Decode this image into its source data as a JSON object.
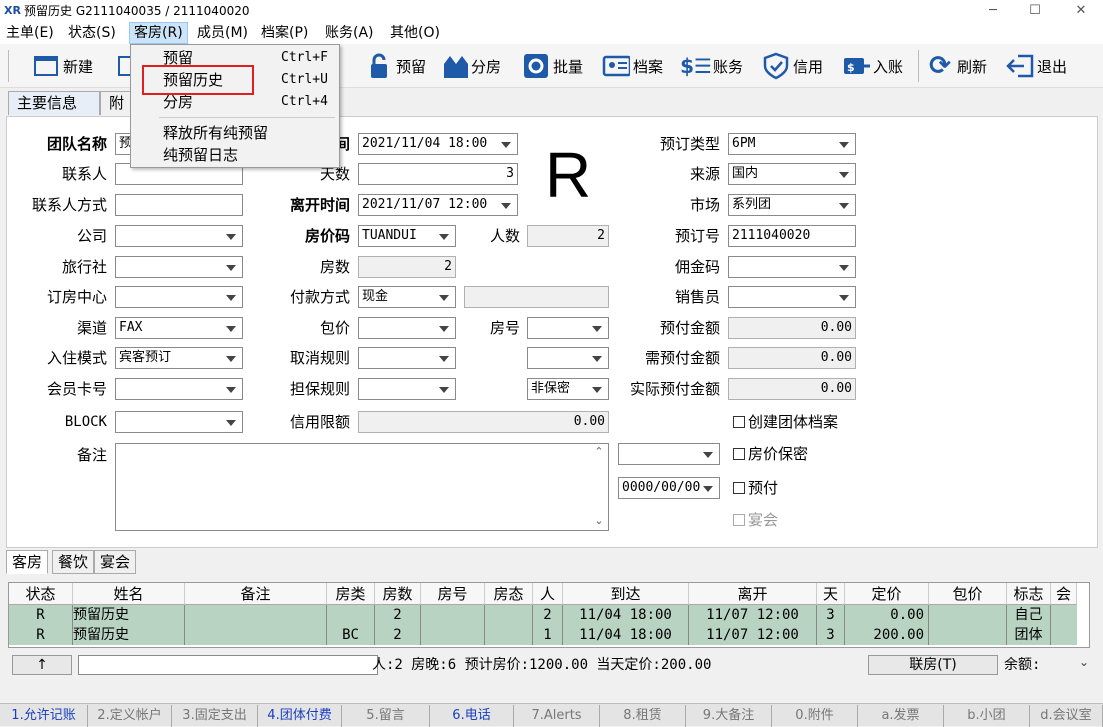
{
  "window": {
    "title": "预留历史  G2111040035  /  2111040020",
    "logo": "XR",
    "min": "─",
    "max": "☐",
    "close": "✕"
  },
  "menubar": [
    "主单(E)",
    "状态(S)",
    "客房(R)",
    "成员(M)",
    "档案(P)",
    "账务(A)",
    "其他(O)"
  ],
  "toolbar": {
    "new": "新建",
    "reserve": "预留",
    "assign": "分房",
    "batch": "批量",
    "profile": "档案",
    "account": "账务",
    "credit": "信用",
    "posting": "入账",
    "refresh": "刷新",
    "exit": "退出"
  },
  "dropdown": {
    "items": [
      {
        "label": "预留",
        "shortcut": "Ctrl+F"
      },
      {
        "label": "预留历史",
        "shortcut": "Ctrl+U"
      },
      {
        "label": "分房",
        "shortcut": "Ctrl+4"
      },
      {
        "label": "释放所有纯预留",
        "shortcut": ""
      },
      {
        "label": "纯预留日志",
        "shortcut": ""
      }
    ]
  },
  "tabs": {
    "main": "主要信息",
    "extra": "附加"
  },
  "form": {
    "group_name_label": "团队名称",
    "group_name_value": "预",
    "contact_label": "联系人",
    "contact_method_label": "联系人方式",
    "company_label": "公司",
    "agency_label": "旅行社",
    "booking_center_label": "订房中心",
    "channel_label": "渠道",
    "channel_value": "FAX",
    "checkin_mode_label": "入住模式",
    "checkin_mode_value": "宾客预订",
    "member_card_label": "会员卡号",
    "block_label": "BLOCK",
    "remark_label": "备注",
    "arrival_label": "间",
    "arrival_value": "2021/11/04 18:00",
    "days_label": "天数",
    "days_value": "3",
    "departure_label": "离开时间",
    "departure_value": "2021/11/07 12:00",
    "rate_code_label": "房价码",
    "rate_code_value": "TUANDUI",
    "persons_label": "人数",
    "persons_value": "2",
    "rooms_label": "房数",
    "rooms_value": "2",
    "payment_label": "付款方式",
    "payment_value": "现金",
    "package_label": "包价",
    "room_no_label": "房号",
    "cancel_rule_label": "取消规则",
    "guarantee_label": "担保规则",
    "secret_value": "非保密",
    "credit_limit_label": "信用限额",
    "credit_limit_value": "0.00",
    "status_letter": "R",
    "booking_type_label": "预订类型",
    "booking_type_value": "6PM",
    "source_label": "来源",
    "source_value": "国内",
    "market_label": "市场",
    "market_value": "系列团",
    "booking_no_label": "预订号",
    "booking_no_value": "2111040020",
    "commission_label": "佣金码",
    "sales_label": "销售员",
    "prepay_label": "预付金额",
    "prepay_value": "0.00",
    "need_prepay_label": "需预付金额",
    "need_prepay_value": "0.00",
    "actual_prepay_label": "实际预付金额",
    "actual_prepay_value": "0.00",
    "date_value": "0000/00/00",
    "cb_create_profile": "创建团体档案",
    "cb_rate_secret": "房价保密",
    "cb_prepaid": "预付",
    "cb_banquet": "宴会"
  },
  "subtabs": [
    "客房",
    "餐饮",
    "宴会"
  ],
  "grid": {
    "headers": [
      "状态",
      "姓名",
      "备注",
      "房类",
      "房数",
      "房号",
      "房态",
      "人",
      "到达",
      "离开",
      "天",
      "定价",
      "包价",
      "标志",
      "会"
    ],
    "rows": [
      [
        "R",
        "预留历史",
        "",
        "",
        "2",
        "",
        "",
        "2",
        "11/04 18:00",
        "11/07 12:00",
        "3",
        "0.00",
        "",
        "自己"
      ],
      [
        "R",
        "预留历史",
        "",
        "BC",
        "2",
        "",
        "",
        "1",
        "11/04 18:00",
        "11/07 12:00",
        "3",
        "200.00",
        "",
        "团体"
      ]
    ]
  },
  "summary": {
    "up": "↑",
    "text": "人:2  房晚:6  预计房价:1200.00  当天定价:200.00",
    "link_btn": "联房(T)",
    "balance": "余额:"
  },
  "bottom_tabs": [
    "1.允许记账",
    "2.定义帐户",
    "3.固定支出",
    "4.团体付费",
    "5.留言",
    "6.电话",
    "7.Alerts",
    "8.租赁",
    "9.大备注",
    "0.附件",
    "a.发票",
    "b.小团",
    "d.会议室"
  ]
}
